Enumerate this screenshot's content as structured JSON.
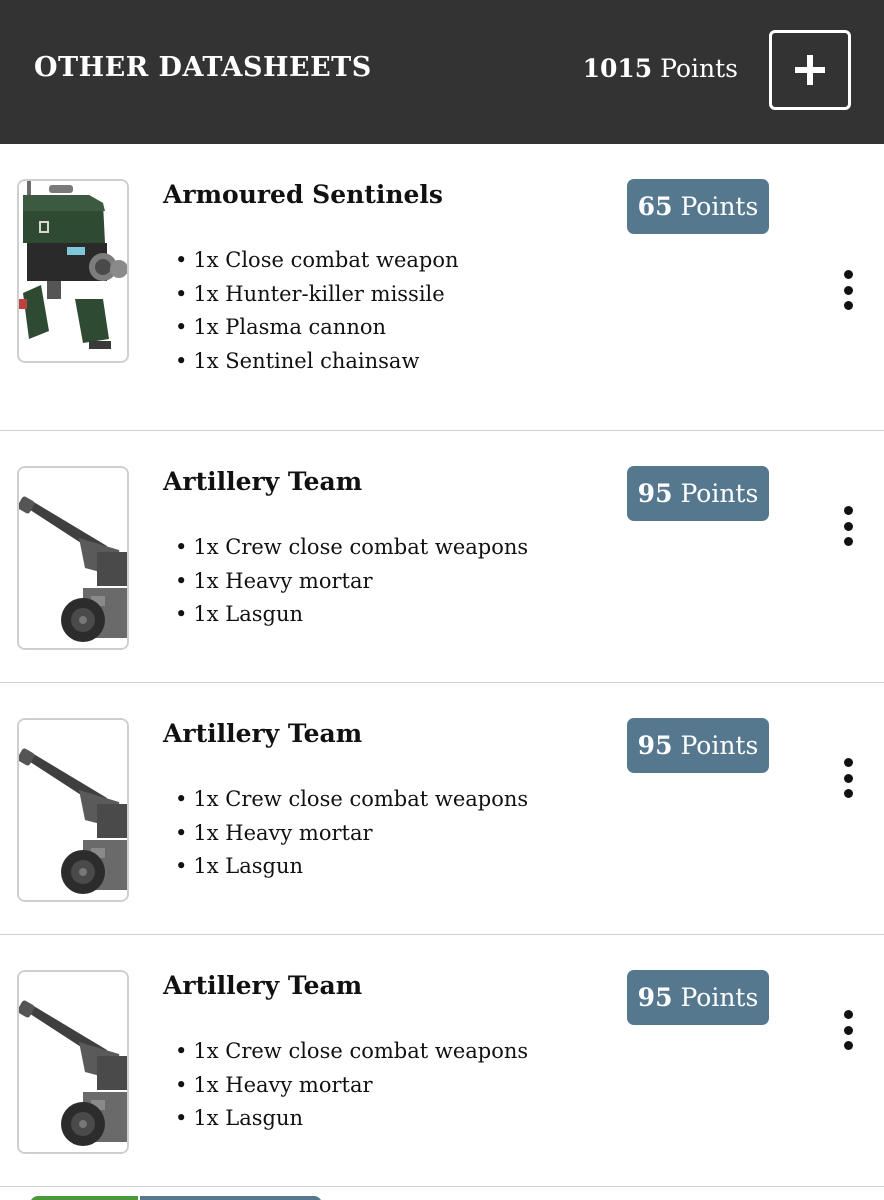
{
  "header": {
    "title": "OTHER DATASHEETS",
    "points_value": "1015",
    "points_label": "Points",
    "add_label": "+"
  },
  "units": [
    {
      "name": "Armoured Sentinels",
      "points_value": "65",
      "points_label": "Points",
      "image_icon": "sentinel-walker-icon",
      "wargear": [
        "1x Close combat weapon",
        "1x Hunter-killer missile",
        "1x Plasma cannon",
        "1x Sentinel chainsaw"
      ]
    },
    {
      "name": "Artillery Team",
      "points_value": "95",
      "points_label": "Points",
      "image_icon": "artillery-cannon-icon",
      "wargear": [
        "1x Crew close combat weapons",
        "1x Heavy mortar",
        "1x Lasgun"
      ]
    },
    {
      "name": "Artillery Team",
      "points_value": "95",
      "points_label": "Points",
      "image_icon": "artillery-cannon-icon",
      "wargear": [
        "1x Crew close combat weapons",
        "1x Heavy mortar",
        "1x Lasgun"
      ]
    },
    {
      "name": "Artillery Team",
      "points_value": "95",
      "points_label": "Points",
      "image_icon": "artillery-cannon-icon",
      "wargear": [
        "1x Crew close combat weapons",
        "1x Heavy mortar",
        "1x Lasgun"
      ]
    }
  ],
  "colors": {
    "header_bg": "#333333",
    "badge_bg": "#56788f",
    "bottom_green": "#4a9a3c"
  }
}
